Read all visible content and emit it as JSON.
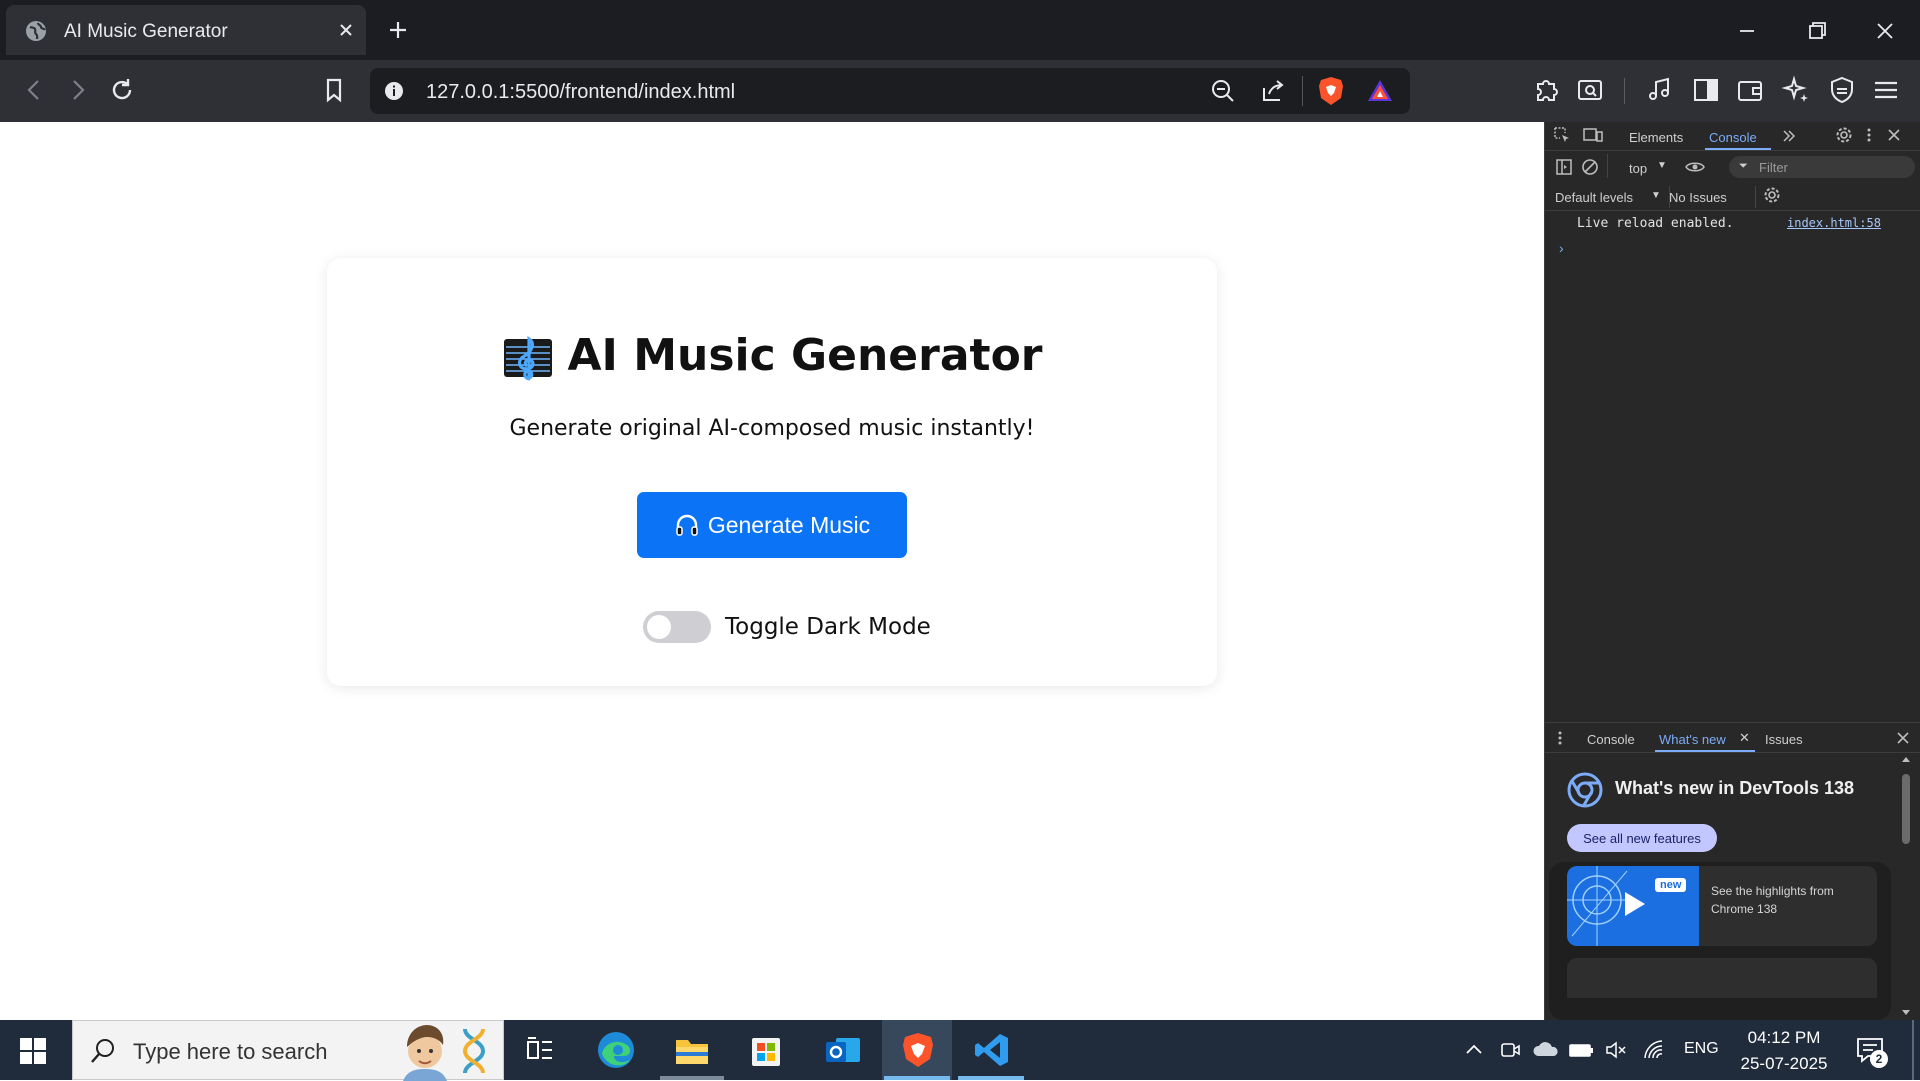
{
  "browser": {
    "tab_title": "AI Music Generator",
    "url": "127.0.0.1:5500/frontend/index.html"
  },
  "page": {
    "title": "AI Music Generator",
    "subtitle": "Generate original AI-composed music instantly!",
    "generate_button": "Generate Music",
    "toggle_label": "Toggle Dark Mode",
    "dark_mode_on": false
  },
  "devtools": {
    "tabs": [
      "Elements",
      "Console"
    ],
    "active_tab": "Console",
    "context": "top",
    "filter_placeholder": "Filter",
    "levels": "Default levels",
    "issues": "No Issues",
    "log_message": "Live reload enabled.",
    "log_source": "index.html:58",
    "drawer_tabs": [
      "Console",
      "What's new",
      "Issues"
    ],
    "drawer_active": "What's new",
    "whats_new_title": "What's new in DevTools 138",
    "whats_new_button": "See all new features",
    "card_badge": "new",
    "card_text": "See the highlights from Chrome 138"
  },
  "taskbar": {
    "search_placeholder": "Type here to search",
    "language": "ENG",
    "time": "04:12 PM",
    "date": "25-07-2025",
    "notification_count": "2"
  },
  "colors": {
    "primary_button": "#0b73f6",
    "devtools_accent": "#7cacf8",
    "taskbar": "#202c3b"
  }
}
